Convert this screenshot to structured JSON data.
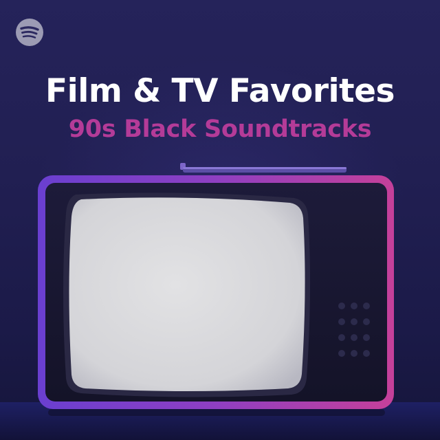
{
  "brand": {
    "logo_icon": "spotify-logo-icon",
    "logo_color": "#ffffff"
  },
  "cover": {
    "title": "Film & TV Favorites",
    "subtitle": "90s Black Soundtracks",
    "title_color": "#ffffff",
    "subtitle_color": "#b43b98",
    "background_color": "#221f52",
    "tv_frame_color": "#9b3fb6",
    "tv_screen_color": "#d7d7da"
  }
}
